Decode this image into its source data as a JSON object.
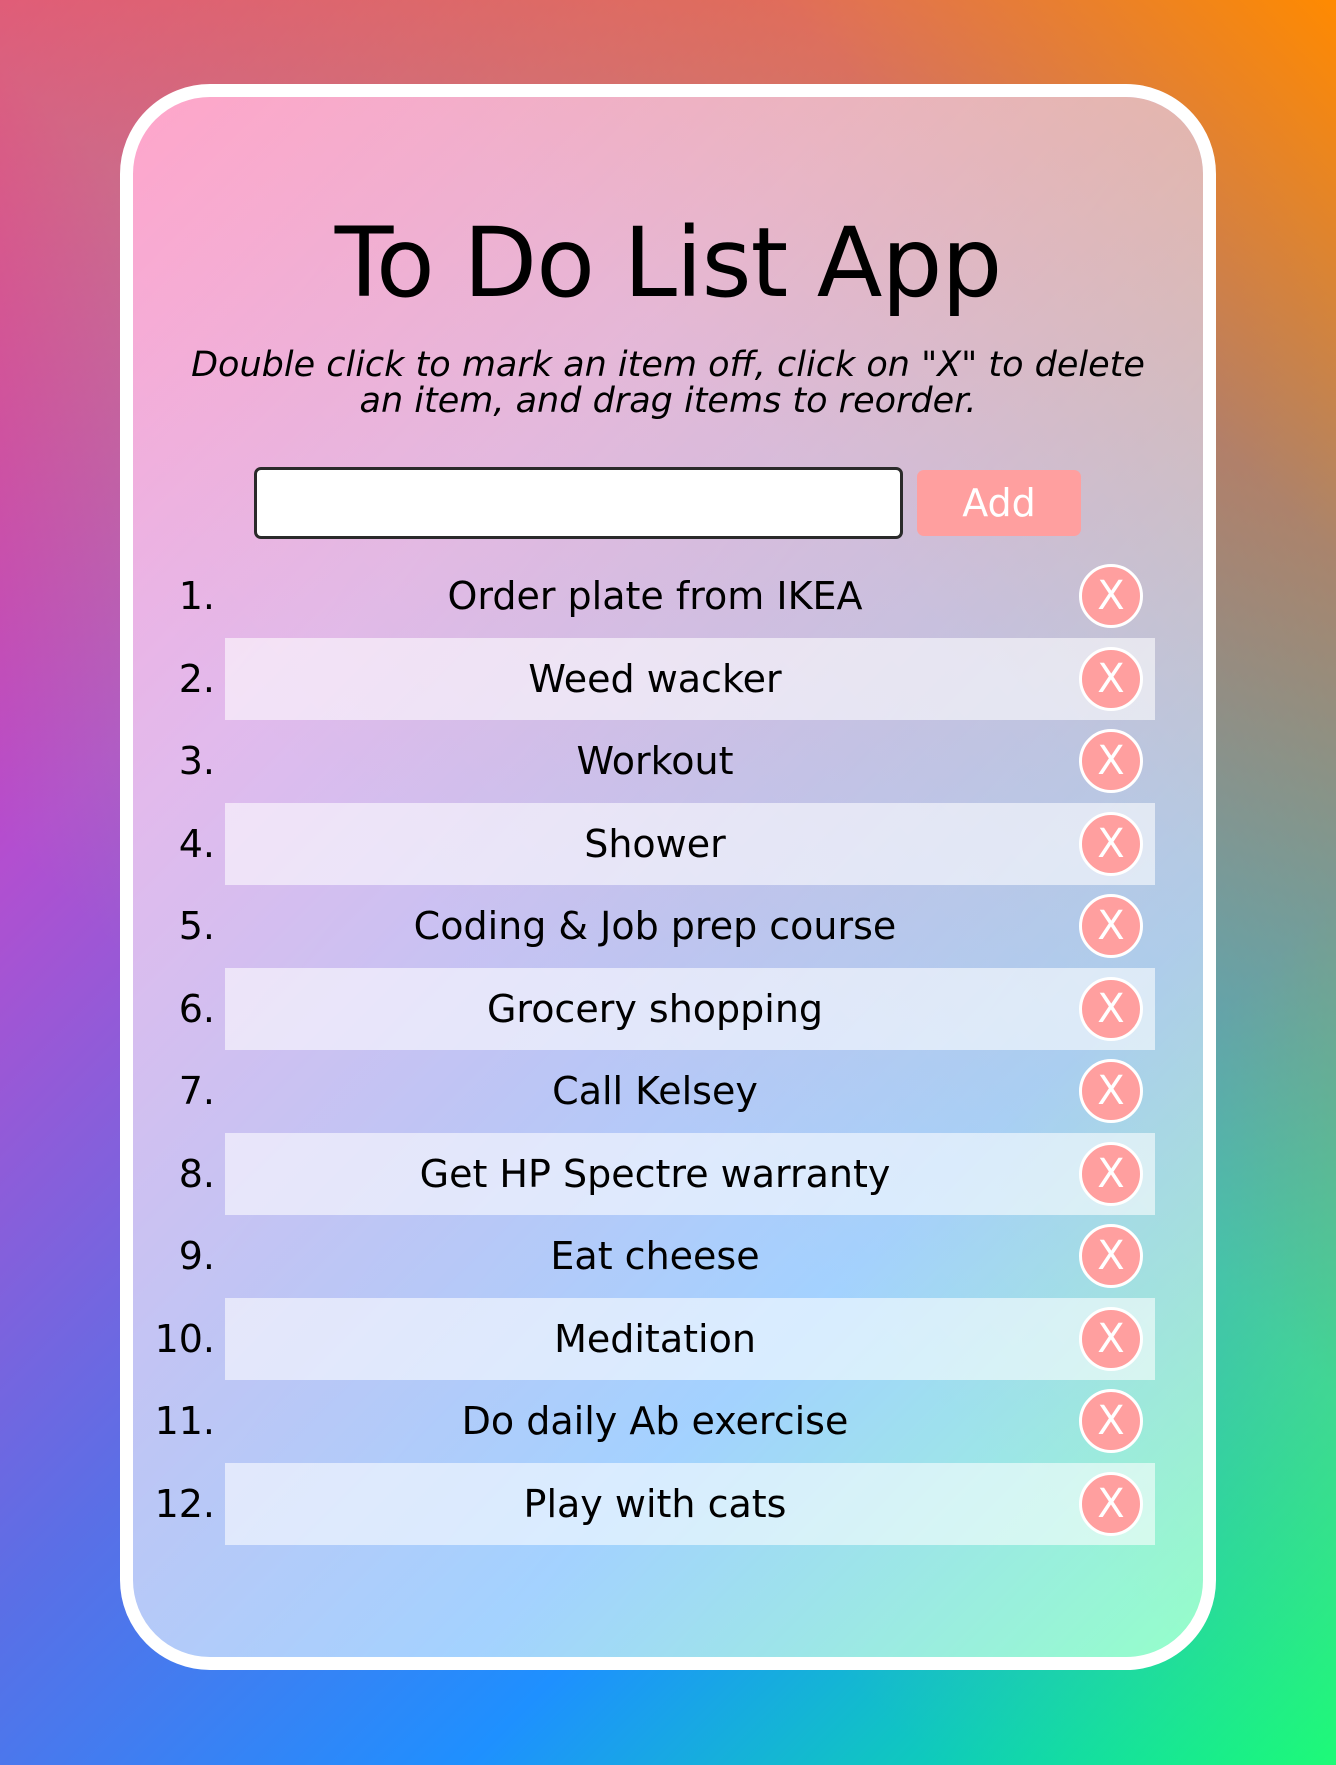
{
  "app": {
    "title": "To Do List App",
    "instructions": "Double click to mark an item off, click on \"X\" to delete an item, and drag items to reorder."
  },
  "input": {
    "value": "",
    "placeholder": ""
  },
  "add_button": {
    "label": "Add"
  },
  "todos": [
    {
      "number": "1.",
      "text": "Order plate from IKEA",
      "delete_label": "X"
    },
    {
      "number": "2.",
      "text": "Weed wacker",
      "delete_label": "X"
    },
    {
      "number": "3.",
      "text": "Workout",
      "delete_label": "X"
    },
    {
      "number": "4.",
      "text": "Shower",
      "delete_label": "X"
    },
    {
      "number": "5.",
      "text": "Coding & Job prep course",
      "delete_label": "X"
    },
    {
      "number": "6.",
      "text": "Grocery shopping",
      "delete_label": "X"
    },
    {
      "number": "7.",
      "text": "Call Kelsey",
      "delete_label": "X"
    },
    {
      "number": "8.",
      "text": "Get HP Spectre warranty",
      "delete_label": "X"
    },
    {
      "number": "9.",
      "text": "Eat cheese",
      "delete_label": "X"
    },
    {
      "number": "10.",
      "text": "Meditation",
      "delete_label": "X"
    },
    {
      "number": "11.",
      "text": "Do daily Ab exercise",
      "delete_label": "X"
    },
    {
      "number": "12.",
      "text": "Play with cats",
      "delete_label": "X"
    }
  ],
  "colors": {
    "accent": "#ff9f9f",
    "card_border": "#ffffff"
  }
}
